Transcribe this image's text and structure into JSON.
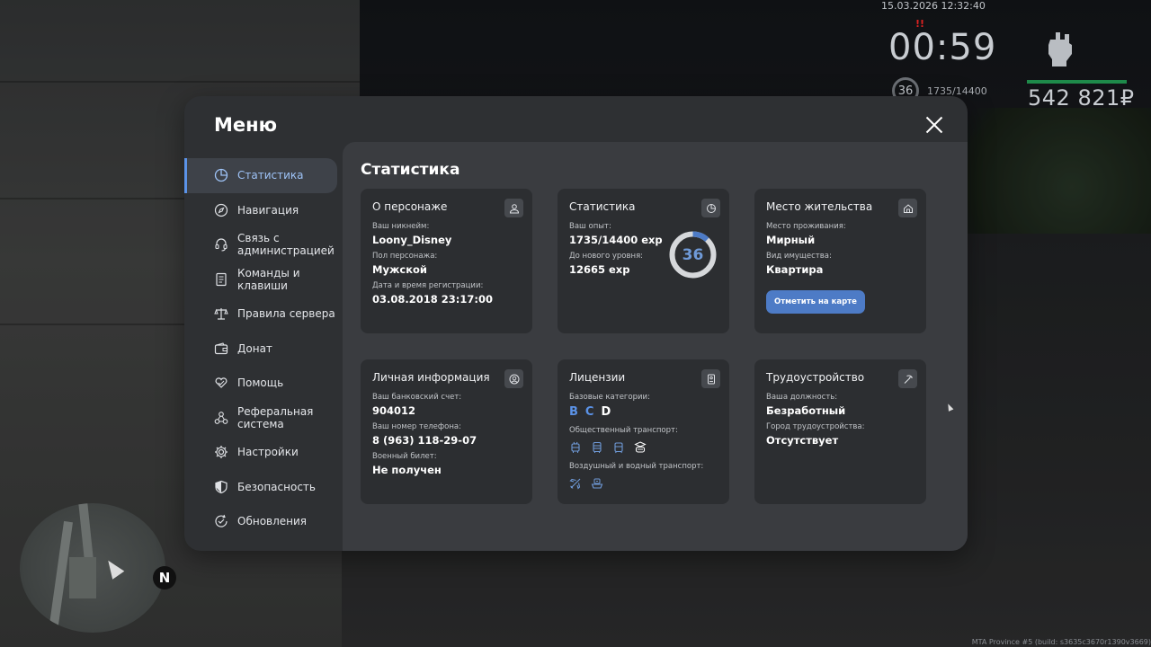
{
  "hud": {
    "datetime": "15.03.2026 12:32:40",
    "wanted": "!!",
    "clock": "00:59",
    "level": "36",
    "exp": "1735/14400",
    "money": "542 821₽",
    "build": "MTA Province #5 (build: s3635c3670r1390v3669)",
    "compass": "N"
  },
  "menu": {
    "title": "Меню",
    "close_icon": "close-icon",
    "sidebar": [
      {
        "label": "Статистика",
        "icon": "pie-chart-icon",
        "active": true
      },
      {
        "label": "Навигация",
        "icon": "compass-icon"
      },
      {
        "label": "Связь с\nадминистрацией",
        "icon": "headset-icon"
      },
      {
        "label": "Команды и\nклавиши",
        "icon": "document-icon"
      },
      {
        "label": "Правила сервера",
        "icon": "scales-icon"
      },
      {
        "label": "Донат",
        "icon": "wallet-icon"
      },
      {
        "label": "Помощь",
        "icon": "heart-hand-icon"
      },
      {
        "label": "Реферальная\nсистема",
        "icon": "network-icon"
      },
      {
        "label": "Настройки",
        "icon": "gear-icon"
      },
      {
        "label": "Безопасность",
        "icon": "shield-icon"
      },
      {
        "label": "Обновления",
        "icon": "refresh-check-icon"
      }
    ]
  },
  "content": {
    "title": "Статистика",
    "character": {
      "title": "О персонаже",
      "nick_label": "Ваш никнейм:",
      "nick": "Loony_Disney",
      "gender_label": "Пол персонажа:",
      "gender": "Мужской",
      "reg_label": "Дата и время регистрации:",
      "reg": "03.08.2018 23:17:00"
    },
    "stats": {
      "title": "Статистика",
      "exp_label": "Ваш опыт:",
      "exp": "1735/14400 exp",
      "next_label": "До нового уровня:",
      "next": "12665 exp",
      "level": "36",
      "progress": 0.12
    },
    "residence": {
      "title": "Место жительства",
      "place_label": "Место проживания:",
      "place": "Мирный",
      "type_label": "Вид имущества:",
      "type": "Квартира",
      "button": "Отметить на карте"
    },
    "personal": {
      "title": "Личная информация",
      "bank_label": "Ваш банковский счет:",
      "bank": "904012",
      "phone_label": "Ваш номер телефона:",
      "phone": "8 (963) 118-29-07",
      "military_label": "Военный билет:",
      "military": "Не получен"
    },
    "licenses": {
      "title": "Лицензии",
      "base_label": "Базовые категории:",
      "cats": [
        "B",
        "C",
        "D"
      ],
      "public_label": "Общественный транспорт:",
      "air_label": "Воздушный и водный транспорт:"
    },
    "employment": {
      "title": "Трудоустройство",
      "position_label": "Ваша должность:",
      "position": "Безработный",
      "city_label": "Город трудоустройства:",
      "city": "Отсутствует"
    }
  },
  "colors": {
    "accent": "#5b93e8",
    "button": "#4d7bc6",
    "modal_bg": "#2e3033",
    "content_bg": "#3a3c40",
    "card_bg": "#2c2e31"
  }
}
